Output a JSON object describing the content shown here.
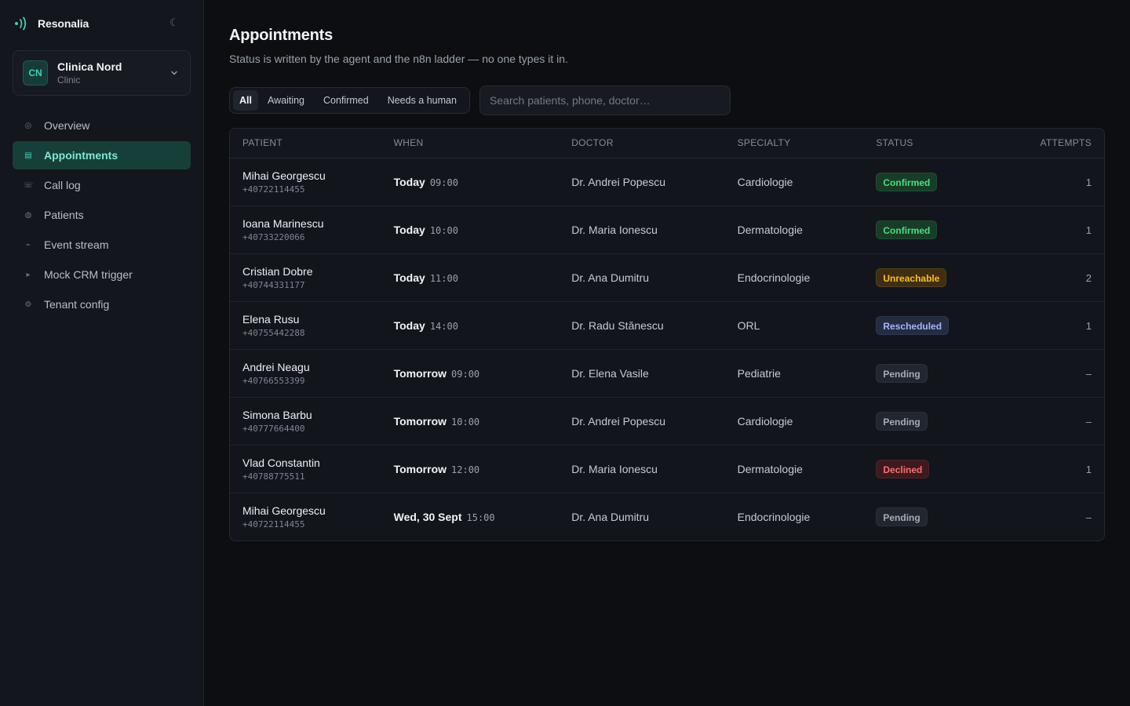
{
  "app": {
    "name": "Resonalia"
  },
  "tenant": {
    "initials": "CN",
    "name": "Clinica Nord",
    "type": "Clinic"
  },
  "nav": {
    "items": [
      {
        "label": "Overview",
        "icon": "target-icon"
      },
      {
        "label": "Appointments",
        "icon": "list-icon",
        "active": true
      },
      {
        "label": "Call log",
        "icon": "phone-icon"
      },
      {
        "label": "Patients",
        "icon": "users-icon"
      },
      {
        "label": "Event stream",
        "icon": "stream-icon"
      },
      {
        "label": "Mock CRM trigger",
        "icon": "play-icon"
      },
      {
        "label": "Tenant config",
        "icon": "gear-icon"
      }
    ]
  },
  "page": {
    "title": "Appointments",
    "subtitle": "Status is written by the agent and the n8n ladder — no one types it in."
  },
  "filters": {
    "tabs": [
      "All",
      "Awaiting",
      "Confirmed",
      "Needs a human"
    ],
    "active": "All"
  },
  "search": {
    "placeholder": "Search patients, phone, doctor…",
    "value": ""
  },
  "table": {
    "columns": [
      "Patient",
      "When",
      "Doctor",
      "Specialty",
      "Status",
      "Attempts"
    ],
    "rows": [
      {
        "name": "Mihai Georgescu",
        "phone": "+40722114455",
        "day": "Today",
        "time": "09:00",
        "doctor": "Dr. Andrei Popescu",
        "specialty": "Cardiologie",
        "status": "Confirmed",
        "attempts": "1"
      },
      {
        "name": "Ioana Marinescu",
        "phone": "+40733220066",
        "day": "Today",
        "time": "10:00",
        "doctor": "Dr. Maria Ionescu",
        "specialty": "Dermatologie",
        "status": "Confirmed",
        "attempts": "1"
      },
      {
        "name": "Cristian Dobre",
        "phone": "+40744331177",
        "day": "Today",
        "time": "11:00",
        "doctor": "Dr. Ana Dumitru",
        "specialty": "Endocrinologie",
        "status": "Unreachable",
        "attempts": "2"
      },
      {
        "name": "Elena Rusu",
        "phone": "+40755442288",
        "day": "Today",
        "time": "14:00",
        "doctor": "Dr. Radu Stănescu",
        "specialty": "ORL",
        "status": "Rescheduled",
        "attempts": "1"
      },
      {
        "name": "Andrei Neagu",
        "phone": "+40766553399",
        "day": "Tomorrow",
        "time": "09:00",
        "doctor": "Dr. Elena Vasile",
        "specialty": "Pediatrie",
        "status": "Pending",
        "attempts": "–"
      },
      {
        "name": "Simona Barbu",
        "phone": "+40777664400",
        "day": "Tomorrow",
        "time": "10:00",
        "doctor": "Dr. Andrei Popescu",
        "specialty": "Cardiologie",
        "status": "Pending",
        "attempts": "–"
      },
      {
        "name": "Vlad Constantin",
        "phone": "+40788775511",
        "day": "Tomorrow",
        "time": "12:00",
        "doctor": "Dr. Maria Ionescu",
        "specialty": "Dermatologie",
        "status": "Declined",
        "attempts": "1"
      },
      {
        "name": "Mihai Georgescu",
        "phone": "+40722114455",
        "day": "Wed, 30 Sept",
        "time": "15:00",
        "doctor": "Dr. Ana Dumitru",
        "specialty": "Endocrinologie",
        "status": "Pending",
        "attempts": "–"
      }
    ]
  },
  "colors": {
    "accent": "#3ed2b6",
    "confirmed": "#4ade80",
    "unreachable": "#fbbf24",
    "rescheduled": "#a5b4fc",
    "pending": "#a6acb7",
    "declined": "#f87171"
  }
}
